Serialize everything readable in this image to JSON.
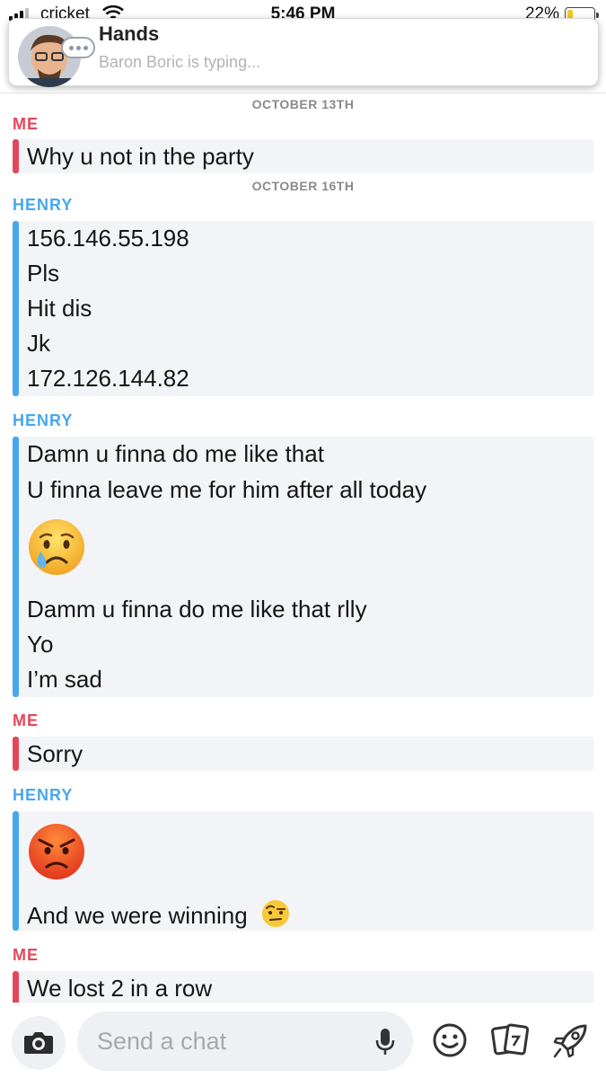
{
  "status_bar": {
    "carrier": "cricket",
    "time": "5:46 PM",
    "battery": "22%",
    "battery_level": 0.22
  },
  "notification": {
    "title": "Hands",
    "subtitle": "Baron Boric is typing..."
  },
  "chat": {
    "date_1": "OCTOBER 13TH",
    "date_2": "OCTOBER 16TH",
    "messages": [
      {
        "sender": "ME",
        "lines": [
          "Why u not in the party"
        ]
      },
      {
        "sender": "HENRY",
        "lines": [
          "156.146.55.198",
          "Pls",
          "Hit dis",
          "Jk",
          "172.126.144.82"
        ]
      },
      {
        "sender": "HENRY",
        "lines": [
          "Damn u finna do me like that",
          "U finna leave me for him after all today",
          "crying-face-emoji",
          "Damm u finna do me like that rlly",
          "Yo",
          "I’m sad"
        ]
      },
      {
        "sender": "ME",
        "lines": [
          "Sorry"
        ]
      },
      {
        "sender": "HENRY",
        "lines": [
          "angry-face-emoji",
          "And we were winning"
        ]
      },
      {
        "sender": "ME",
        "lines": [
          "We lost 2 in a row"
        ]
      }
    ]
  },
  "input": {
    "placeholder": "Send a chat"
  },
  "icons": {
    "camera": "camera-icon",
    "mic": "microphone-icon",
    "smiley": "smiley-icon",
    "stickers": "stickers-icon",
    "rocket": "rocket-icon"
  },
  "colors": {
    "me": "#e4475a",
    "henry": "#47a7ec",
    "bubble": "#f3f4f7"
  }
}
